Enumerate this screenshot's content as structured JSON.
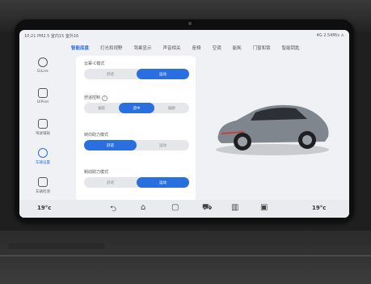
{
  "status": {
    "time": "10:21 PM2.5 室内15 室外16",
    "right": "4G 2.54M/s ⚠"
  },
  "sidebar": {
    "items": [
      {
        "label": "DiLink",
        "active": false
      },
      {
        "label": "DiPilot",
        "active": false
      },
      {
        "label": "驾驶辅助",
        "active": false
      },
      {
        "label": "车辆设置",
        "active": true
      },
      {
        "label": "车辆检测",
        "active": false
      }
    ]
  },
  "tabs": [
    "智能底盘",
    "灯光和视野",
    "驾乘显示",
    "声音相关",
    "座椅",
    "空调",
    "能耗",
    "门窗和锁",
    "智能钥匙"
  ],
  "settings": [
    {
      "title": "云辇-C模式",
      "options": [
        "舒适",
        "运动"
      ],
      "selected": 1
    },
    {
      "title": "舒适控制",
      "info": "?",
      "options": [
        "偏软",
        "适中",
        "偏硬"
      ],
      "selected": 1
    },
    {
      "title": "转向助力模式",
      "options": [
        "舒适",
        "运动"
      ],
      "selected": 0
    },
    {
      "title": "制动助力模式",
      "options": [
        "舒适",
        "运动"
      ],
      "selected": 1
    }
  ],
  "navbar": {
    "temp_left": "19°c",
    "temp_right": "19°c"
  },
  "colors": {
    "accent": "#2a6fe0",
    "car_body": "#7f868d"
  }
}
